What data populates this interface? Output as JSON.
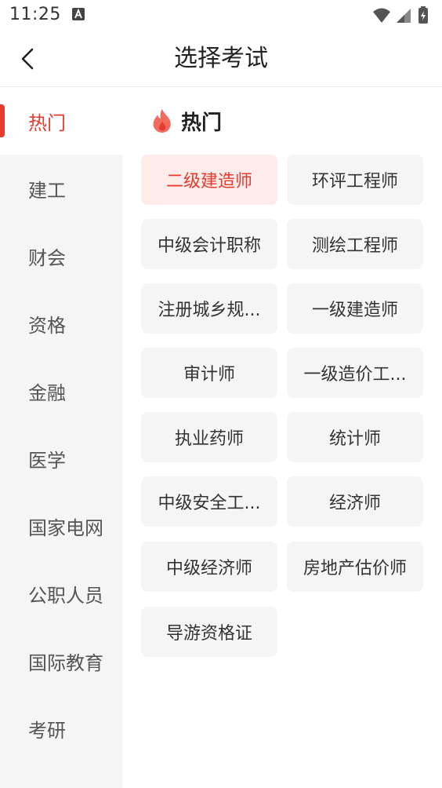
{
  "status_bar": {
    "time": "11:25"
  },
  "header": {
    "title": "选择考试"
  },
  "sidebar": {
    "items": [
      {
        "label": "热门",
        "active": true
      },
      {
        "label": "建工"
      },
      {
        "label": "财会"
      },
      {
        "label": "资格"
      },
      {
        "label": "金融"
      },
      {
        "label": "医学"
      },
      {
        "label": "国家电网"
      },
      {
        "label": "公职人员"
      },
      {
        "label": "国际教育"
      },
      {
        "label": "考研"
      }
    ]
  },
  "main": {
    "section_title": "热门",
    "exams": [
      {
        "label": "二级建造师",
        "selected": true
      },
      {
        "label": "环评工程师"
      },
      {
        "label": "中级会计职称"
      },
      {
        "label": "测绘工程师"
      },
      {
        "label": "注册城乡规..."
      },
      {
        "label": "一级建造师"
      },
      {
        "label": "审计师"
      },
      {
        "label": "一级造价工..."
      },
      {
        "label": "执业药师"
      },
      {
        "label": "统计师"
      },
      {
        "label": "中级安全工..."
      },
      {
        "label": "经济师"
      },
      {
        "label": "中级经济师"
      },
      {
        "label": "房地产估价师"
      },
      {
        "label": "导游资格证"
      }
    ]
  },
  "colors": {
    "accent": "#e53b31",
    "accent_light": "#fdecea",
    "sidebar_bg": "#f5f5f5",
    "button_bg": "#f5f5f5"
  }
}
